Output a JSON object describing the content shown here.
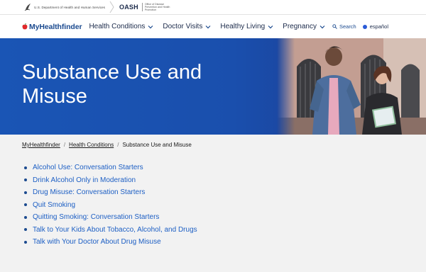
{
  "gov_bar": {
    "hhs_text": "U.S. Department of Health and Human Services",
    "oash_logo": "OASH",
    "oash_sub": "Office of Disease Prevention and Health Promotion"
  },
  "nav": {
    "brand": "MyHealthfinder",
    "items": [
      {
        "label": "Health Conditions"
      },
      {
        "label": "Doctor Visits"
      },
      {
        "label": "Healthy Living"
      },
      {
        "label": "Pregnancy"
      }
    ],
    "search_label": "Search",
    "lang_label": "español"
  },
  "hero": {
    "title": "Substance Use and Misuse"
  },
  "breadcrumb": {
    "home": "MyHealthfinder",
    "section": "Health Conditions",
    "current": "Substance Use and Misuse",
    "separator": "/"
  },
  "links": [
    {
      "label": "Alcohol Use: Conversation Starters"
    },
    {
      "label": "Drink Alcohol Only in Moderation"
    },
    {
      "label": "Drug Misuse: Conversation Starters"
    },
    {
      "label": "Quit Smoking"
    },
    {
      "label": "Quitting Smoking: Conversation Starters"
    },
    {
      "label": "Talk to Your Kids About Tobacco, Alcohol, and Drugs"
    },
    {
      "label": "Talk with Your Doctor About Drug Misuse"
    }
  ],
  "colors": {
    "hero_blue": "#1a55b5",
    "link_blue": "#1d5fc4",
    "nav_text": "#1b2a4a",
    "brand_red": "#e0292b"
  }
}
